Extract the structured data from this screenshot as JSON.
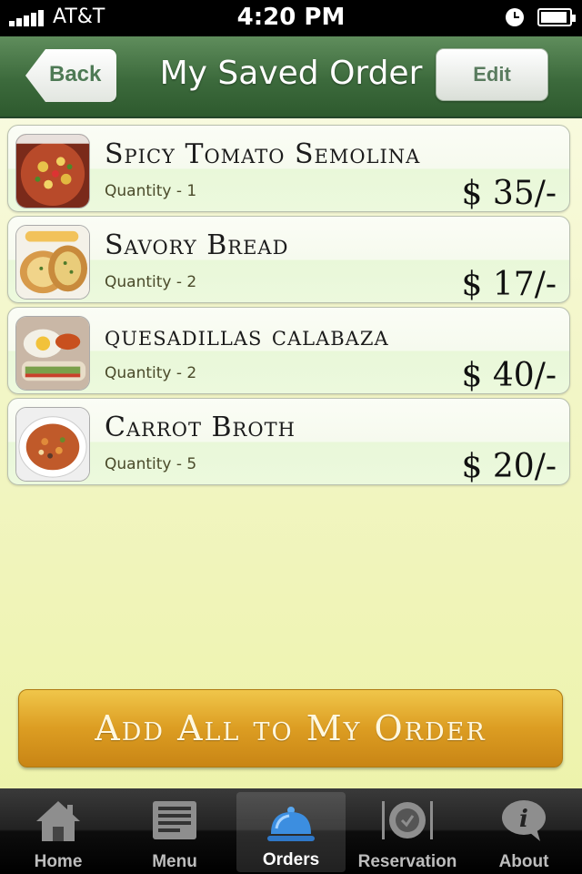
{
  "status_bar": {
    "carrier": "AT&T",
    "time": "4:20 PM"
  },
  "nav": {
    "title": "My Saved Order",
    "back_label": "Back",
    "edit_label": "Edit"
  },
  "orders": [
    {
      "name": "Spicy Tomato Semolina",
      "quantity": "Quantity - 1",
      "price": "$ 35/-",
      "thumb": "pasta-dish"
    },
    {
      "name": "Savory Bread",
      "quantity": "Quantity - 2",
      "price": "$ 17/-",
      "thumb": "bread-dish"
    },
    {
      "name": "quesadillas calabaza",
      "quantity": "Quantity - 2",
      "price": "$ 40/-",
      "thumb": "quesadilla-dish"
    },
    {
      "name": "Carrot Broth",
      "quantity": "Quantity - 5",
      "price": "$ 20/-",
      "thumb": "soup-dish"
    }
  ],
  "add_all_label": "Add All to My Order",
  "tabs": [
    {
      "label": "Home",
      "icon": "house-icon"
    },
    {
      "label": "Menu",
      "icon": "menu-icon"
    },
    {
      "label": "Orders",
      "icon": "cloche-icon",
      "active": true
    },
    {
      "label": "Reservation",
      "icon": "plate-cutlery-icon"
    },
    {
      "label": "About",
      "icon": "info-bubble-icon"
    }
  ],
  "colors": {
    "nav_green": "#3c6a3c",
    "button_gold": "#dc9d22",
    "row_green": "#e9f8d9",
    "active_tab_blue": "#3c8ee0"
  }
}
